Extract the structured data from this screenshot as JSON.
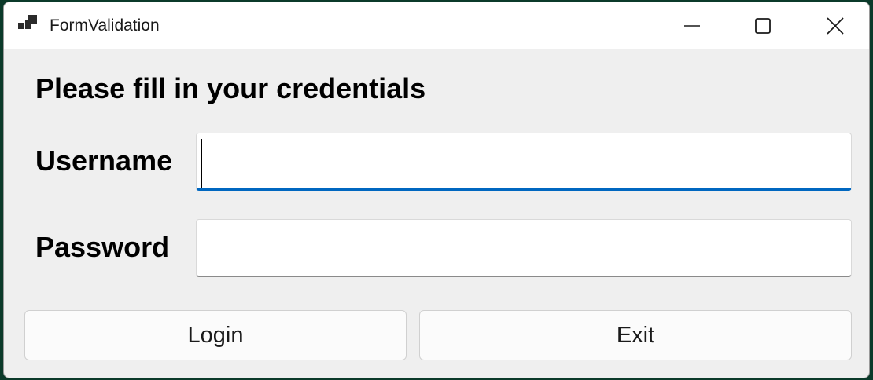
{
  "window": {
    "title": "FormValidation",
    "controls": {
      "minimize_icon": "minimize-icon",
      "maximize_icon": "maximize-icon",
      "close_icon": "close-icon"
    }
  },
  "form": {
    "heading": "Please fill in your credentials",
    "username": {
      "label": "Username",
      "value": "",
      "placeholder": ""
    },
    "password": {
      "label": "Password",
      "value": "",
      "placeholder": ""
    }
  },
  "buttons": {
    "login_label": "Login",
    "exit_label": "Exit"
  },
  "colors": {
    "focus_accent": "#0067c0",
    "window_background": "#efefef",
    "titlebar_background": "#ffffff"
  }
}
